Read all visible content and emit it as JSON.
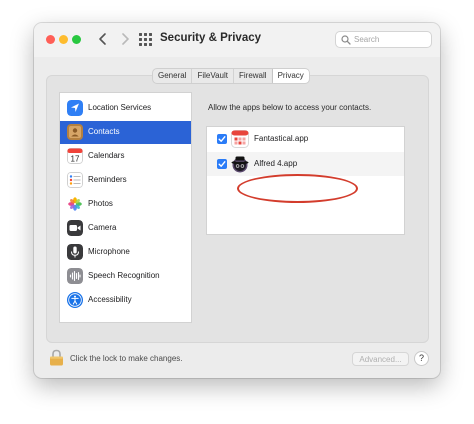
{
  "window": {
    "title": "Security & Privacy",
    "search_placeholder": "Search"
  },
  "tabs": [
    {
      "label": "General",
      "active": false
    },
    {
      "label": "FileVault",
      "active": false
    },
    {
      "label": "Firewall",
      "active": false
    },
    {
      "label": "Privacy",
      "active": true
    }
  ],
  "sidebar": {
    "items": [
      {
        "label": "Location Services",
        "icon": "location-arrow-icon",
        "selected": false
      },
      {
        "label": "Contacts",
        "icon": "contacts-book-icon",
        "selected": true
      },
      {
        "label": "Calendars",
        "icon": "calendar-icon",
        "selected": false
      },
      {
        "label": "Reminders",
        "icon": "reminders-list-icon",
        "selected": false
      },
      {
        "label": "Photos",
        "icon": "photos-flower-icon",
        "selected": false
      },
      {
        "label": "Camera",
        "icon": "camera-icon",
        "selected": false
      },
      {
        "label": "Microphone",
        "icon": "microphone-icon",
        "selected": false
      },
      {
        "label": "Speech Recognition",
        "icon": "waveform-icon",
        "selected": false
      },
      {
        "label": "Accessibility",
        "icon": "accessibility-person-icon",
        "selected": false
      }
    ],
    "calendar_day": "17"
  },
  "main": {
    "instruction": "Allow the apps below to access your contacts.",
    "apps": [
      {
        "name": "Fantastical.app",
        "checked": true,
        "icon": "fantastical-calendar-icon"
      },
      {
        "name": "Alfred 4.app",
        "checked": true,
        "icon": "alfred-hat-icon",
        "highlighted": true
      }
    ]
  },
  "footer": {
    "lock_text": "Click the lock to make changes.",
    "advanced_label": "Advanced...",
    "help_label": "?"
  },
  "colors": {
    "selection": "#2b63d6",
    "checkbox": "#2b7cf7",
    "highlight_ring": "#d33c2c"
  }
}
